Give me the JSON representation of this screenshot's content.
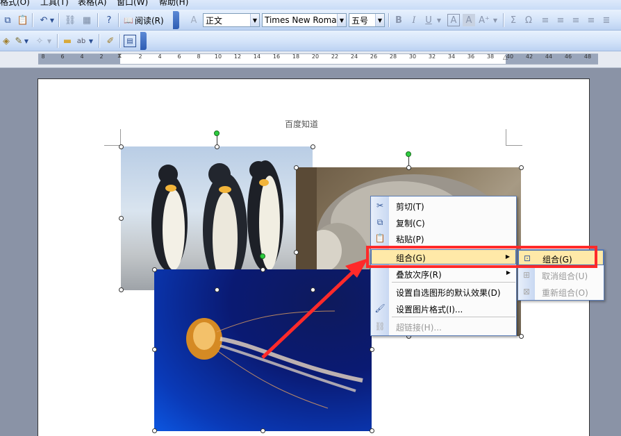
{
  "menubar": {
    "items": [
      "格式(O)",
      "工具(T)",
      "表格(A)",
      "窗口(W)",
      "帮助(H)"
    ]
  },
  "toolbar1": {
    "read_label": "阅读(R)",
    "style_value": "正文",
    "font_value": "Times New Roman",
    "font_display": "Times New Romai",
    "size_value": "五号",
    "icons": [
      "copy-icon",
      "paste-icon",
      "undo-icon",
      "hyperlink-icon",
      "table-icon",
      "help-icon",
      "read-icon",
      "bold-icon",
      "italic-icon",
      "underline-icon",
      "char-border-icon",
      "char-shading-icon",
      "text-effect-icon",
      "sum-icon",
      "omega-icon",
      "align-left-icon",
      "center-icon",
      "align-right-icon",
      "justify-icon"
    ]
  },
  "toolbar2": {
    "icons": [
      "format-painter-icon",
      "highlighter-icon",
      "font-color-icon",
      "folder-icon",
      "spellcheck-icon",
      "edit-icon",
      "document-map-icon"
    ]
  },
  "ruler": {
    "numbers": [
      "8",
      "6",
      "4",
      "2",
      "2",
      "4",
      "6",
      "8",
      "10",
      "12",
      "14",
      "16",
      "18",
      "20",
      "22",
      "24",
      "26",
      "28",
      "30",
      "32",
      "34",
      "36",
      "38",
      "40",
      "42",
      "44",
      "46",
      "48"
    ]
  },
  "page": {
    "header_text": "百度知道"
  },
  "pictures": [
    {
      "name": "penguins-picture",
      "subject": "penguins"
    },
    {
      "name": "koala-picture",
      "subject": "koala"
    },
    {
      "name": "jellyfish-picture",
      "subject": "jellyfish"
    }
  ],
  "context_menu": {
    "items": [
      {
        "label": "剪切(T)",
        "icon": "scissors-icon",
        "enabled": true
      },
      {
        "label": "复制(C)",
        "icon": "copy-icon",
        "enabled": true
      },
      {
        "label": "粘贴(P)",
        "icon": "paste-icon",
        "enabled": true
      },
      {
        "label": "组合(G)",
        "icon": "",
        "enabled": true,
        "submenu": true,
        "highlighted": true
      },
      {
        "label": "叠放次序(R)",
        "icon": "",
        "enabled": true,
        "submenu": true
      },
      {
        "label": "设置自选图形的默认效果(D)",
        "icon": "",
        "enabled": true
      },
      {
        "label": "设置图片格式(I)...",
        "icon": "format-picture-icon",
        "enabled": true
      },
      {
        "label": "超链接(H)...",
        "icon": "hyperlink-icon",
        "enabled": false
      }
    ]
  },
  "submenu": {
    "items": [
      {
        "label": "组合(G)",
        "icon": "group-icon",
        "enabled": true,
        "highlighted": true
      },
      {
        "label": "取消组合(U)",
        "icon": "ungroup-icon",
        "enabled": false
      },
      {
        "label": "重新组合(O)",
        "icon": "regroup-icon",
        "enabled": false
      }
    ]
  },
  "annotation": {
    "color": "#ff2a2a"
  }
}
